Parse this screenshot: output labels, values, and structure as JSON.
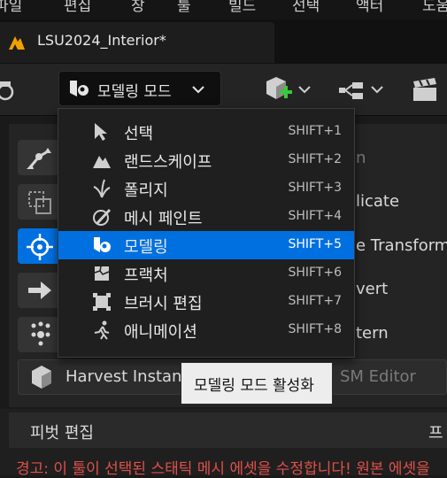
{
  "menubar": [
    "파일",
    "편집",
    "창",
    "툴",
    "빌드",
    "선택",
    "액터",
    "도움"
  ],
  "tab": {
    "title": "LSU2024_Interior*"
  },
  "toolbar": {
    "mode_label": "모델링 모드"
  },
  "panel": {
    "rows": [
      {
        "text": "n"
      },
      {
        "text": "licate"
      },
      {
        "text": "e Transform"
      },
      {
        "text": "vert"
      },
      {
        "text": "tern"
      },
      {
        "text": "Harvest Instan"
      },
      {
        "text": "SM Editor"
      }
    ]
  },
  "dropdown": {
    "items": [
      {
        "label": "선택",
        "shortcut": "SHIFT+1",
        "icon": "select-cursor-icon"
      },
      {
        "label": "랜드스케이프",
        "shortcut": "SHIFT+2",
        "icon": "landscape-icon"
      },
      {
        "label": "폴리지",
        "shortcut": "SHIFT+3",
        "icon": "foliage-icon"
      },
      {
        "label": "메시 페인트",
        "shortcut": "SHIFT+4",
        "icon": "mesh-paint-icon"
      },
      {
        "label": "모델링",
        "shortcut": "SHIFT+5",
        "icon": "modeling-icon",
        "selected": true
      },
      {
        "label": "프랙처",
        "shortcut": "SHIFT+6",
        "icon": "fracture-icon"
      },
      {
        "label": "브러시 편집",
        "shortcut": "SHIFT+7",
        "icon": "brush-edit-icon"
      },
      {
        "label": "애니메이션",
        "shortcut": "SHIFT+8",
        "icon": "animation-icon"
      }
    ]
  },
  "tooltip": {
    "text": "모델링 모드 활성화"
  },
  "bottom": {
    "pivot_title": "피벗 편집",
    "right_label": "프",
    "warning": "경고: 이 툴이 선택된 스태틱 메시 에셋을 수정합니다! 원본 에셋을"
  },
  "colors": {
    "accent": "#0070e0",
    "warning": "#e0504a",
    "brand": "#f0a000"
  }
}
